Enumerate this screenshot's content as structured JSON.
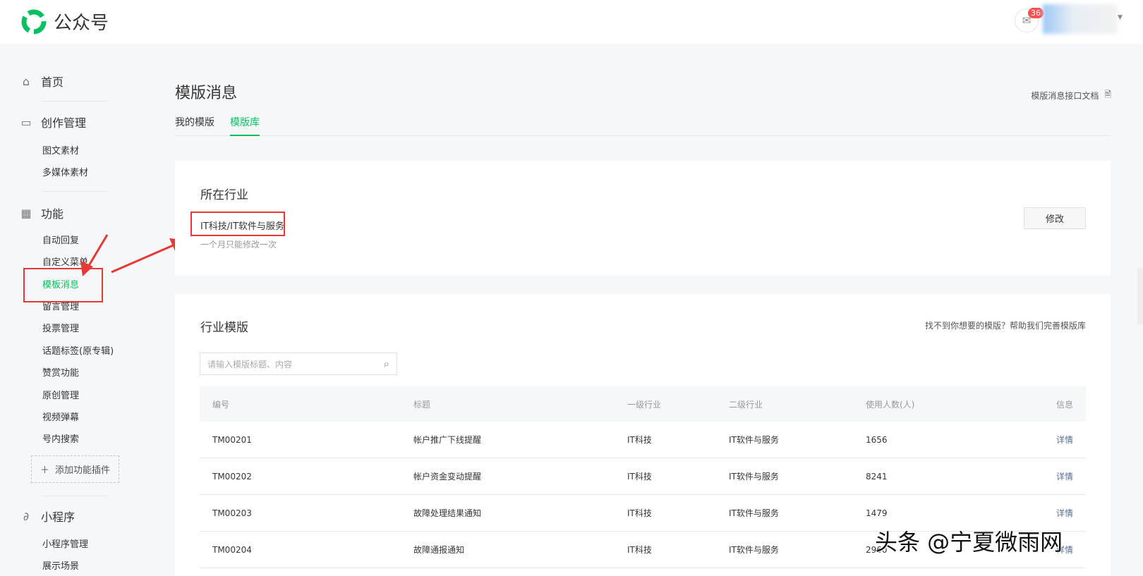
{
  "header": {
    "logo_text": "公众号",
    "mail_count": "36"
  },
  "sidebar": {
    "home": "首页",
    "creation": {
      "label": "创作管理",
      "items": [
        "图文素材",
        "多媒体素材"
      ]
    },
    "features": {
      "label": "功能",
      "items": [
        "自动回复",
        "自定义菜单",
        "模板消息",
        "留言管理",
        "投票管理",
        "话题标签(原专辑)",
        "赞赏功能",
        "原创管理",
        "视频弹幕",
        "号内搜索"
      ],
      "add_plugin": "添加功能插件"
    },
    "miniprogram": {
      "label": "小程序",
      "items": [
        "小程序管理",
        "展示场景"
      ]
    }
  },
  "page": {
    "title": "模版消息",
    "doc_link": "模版消息接口文档",
    "tabs": [
      "我的模版",
      "模版库"
    ],
    "active_tab": "模版库"
  },
  "industry": {
    "title": "所在行业",
    "value": "IT科技/IT软件与服务",
    "note": "一个月只能修改一次",
    "modify": "修改"
  },
  "templates": {
    "title": "行业模版",
    "help": "找不到你想要的模版？帮助我们完善模版库",
    "search_placeholder": "请输入模版标题、内容",
    "columns": [
      "编号",
      "标题",
      "一级行业",
      "二级行业",
      "使用人数(人)",
      "信息"
    ],
    "rows": [
      [
        "TM00201",
        "帐户推广下线提醒",
        "IT科技",
        "IT软件与服务",
        "1656",
        "详情"
      ],
      [
        "TM00202",
        "帐户资金变动提醒",
        "IT科技",
        "IT软件与服务",
        "8241",
        "详情"
      ],
      [
        "TM00203",
        "故障处理结果通知",
        "IT科技",
        "IT软件与服务",
        "1479",
        "详情"
      ],
      [
        "TM00204",
        "故障通报通知",
        "IT科技",
        "IT软件与服务",
        "2960",
        "详情"
      ]
    ]
  },
  "watermark": "头条 @宁夏微雨网",
  "colors": {
    "accent": "#07c160",
    "annotation": "#e53935",
    "link": "#576b95"
  }
}
